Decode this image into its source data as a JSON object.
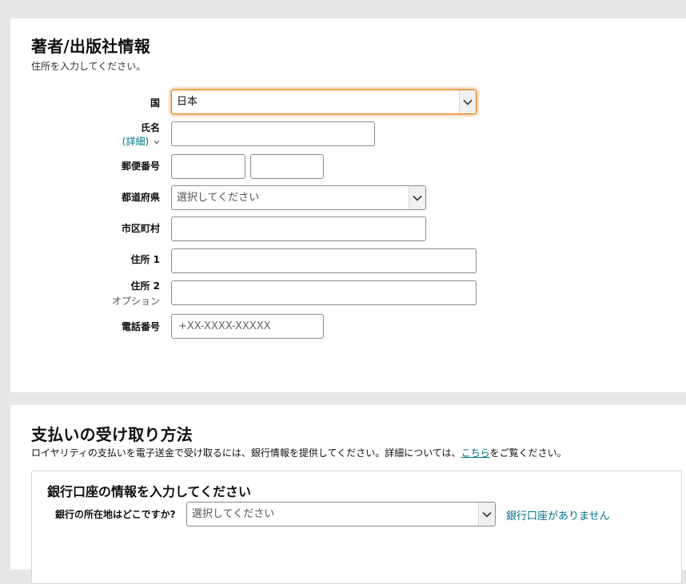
{
  "publisher": {
    "title": "著者/出版社情報",
    "subtitle": "住所を入力してください。",
    "country": {
      "label": "国",
      "value": "日本"
    },
    "name": {
      "label": "氏名",
      "detail_link": "(詳細)"
    },
    "postal": {
      "label": "郵便番号"
    },
    "prefecture": {
      "label": "都道府県",
      "placeholder": "選択してください"
    },
    "city": {
      "label": "市区町村"
    },
    "address1": {
      "label": "住所 1"
    },
    "address2": {
      "label": "住所 2",
      "optional": "オプション"
    },
    "phone": {
      "label": "電話番号",
      "placeholder": "+XX-XXXX-XXXXX"
    }
  },
  "payment": {
    "title": "支払いの受け取り方法",
    "desc_before": "ロイヤリティの支払いを電子送金で受け取るには、銀行情報を提供してください。詳細については、",
    "desc_link": "こちら",
    "desc_after": "をご覧ください。",
    "bank": {
      "title": "銀行口座の情報を入力してください",
      "location_label": "銀行の所在地はどこですか?",
      "location_placeholder": "選択してください",
      "no_account_link": "銀行口座がありません"
    }
  },
  "colors": {
    "link": "#007185",
    "focus": "#e77600"
  }
}
